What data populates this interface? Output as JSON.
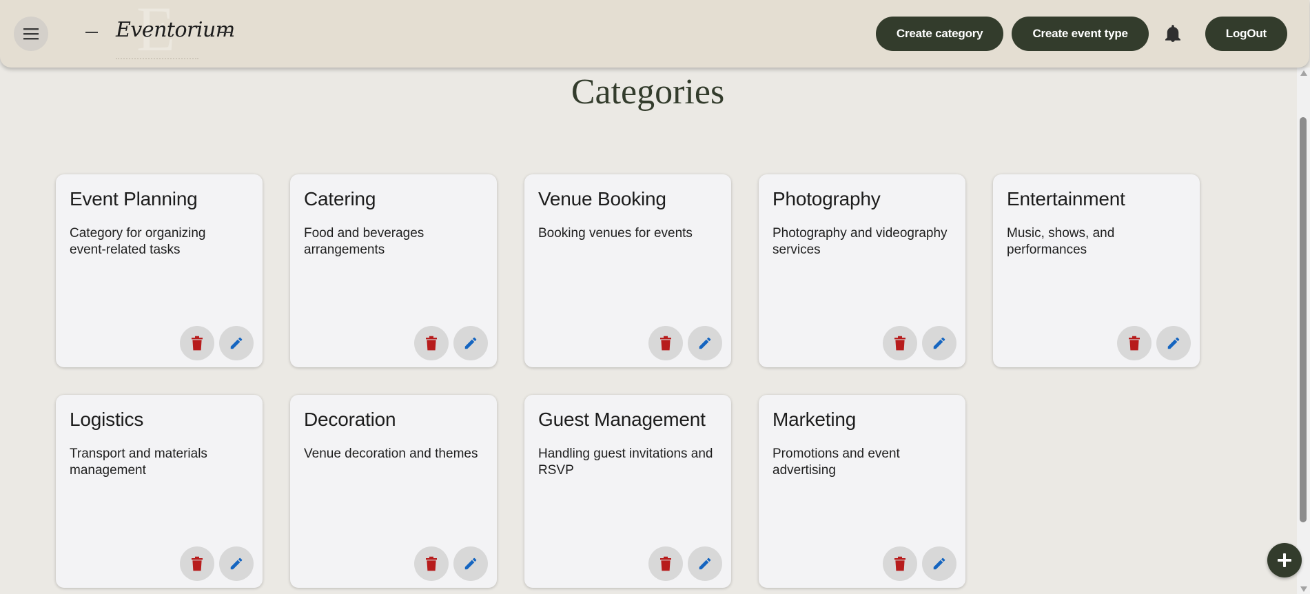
{
  "header": {
    "logo_text": "Eventorium",
    "buttons": {
      "create_category": "Create category",
      "create_event_type": "Create event type",
      "logout": "LogOut"
    }
  },
  "page": {
    "title": "Categories"
  },
  "categories": [
    {
      "title": "Event Planning",
      "description": "Category for organizing event-related tasks"
    },
    {
      "title": "Catering",
      "description": "Food and beverages arrangements"
    },
    {
      "title": "Venue Booking",
      "description": "Booking venues for events"
    },
    {
      "title": "Photography",
      "description": "Photography and videography services"
    },
    {
      "title": "Entertainment",
      "description": "Music, shows, and performances"
    },
    {
      "title": "Logistics",
      "description": "Transport and materials management"
    },
    {
      "title": "Decoration",
      "description": "Venue decoration and themes"
    },
    {
      "title": "Guest Management",
      "description": "Handling guest invitations and RSVP"
    },
    {
      "title": "Marketing",
      "description": "Promotions and event advertising"
    }
  ],
  "icons": {
    "menu": "menu-icon",
    "notifications": "bell-icon",
    "delete": "trash-icon",
    "edit": "pencil-icon",
    "add": "plus-icon"
  },
  "colors": {
    "primary": "#333c2c",
    "header_bg": "#e4ded2",
    "page_bg": "#ebe9e4",
    "card_bg": "#f3f3f5",
    "delete_icon": "#b71c1c",
    "edit_icon": "#1565c0"
  }
}
